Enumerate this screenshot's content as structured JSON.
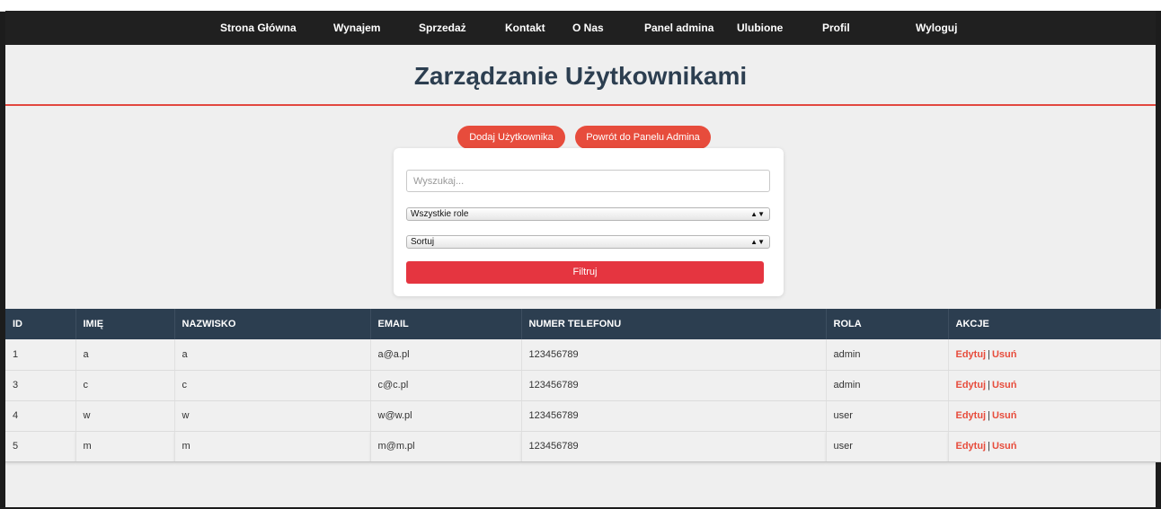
{
  "nav": {
    "items": [
      "Strona Główna",
      "Wynajem",
      "Sprzedaż",
      "Kontakt",
      "O Nas",
      "Panel admina",
      "Ulubione",
      "Profil",
      "Wyloguj"
    ]
  },
  "page": {
    "title": "Zarządzanie Użytkownikami"
  },
  "actions": {
    "add_user": "Dodaj Użytkownika",
    "back_to_admin": "Powrót do Panelu Admina"
  },
  "filter": {
    "search_placeholder": "Wyszukaj...",
    "role_select": "Wszystkie role",
    "sort_select": "Sortuj",
    "filter_button": "Filtruj"
  },
  "table": {
    "headers": [
      "ID",
      "IMIĘ",
      "NAZWISKO",
      "EMAIL",
      "NUMER TELEFONU",
      "ROLA",
      "AKCJE"
    ],
    "edit_label": "Edytuj",
    "separator": "|",
    "delete_label": "Usuń",
    "rows": [
      {
        "id": "1",
        "first": "a",
        "last": "a",
        "email": "a@a.pl",
        "phone": "123456789",
        "role": "admin"
      },
      {
        "id": "3",
        "first": "c",
        "last": "c",
        "email": "c@c.pl",
        "phone": "123456789",
        "role": "admin"
      },
      {
        "id": "4",
        "first": "w",
        "last": "w",
        "email": "w@w.pl",
        "phone": "123456789",
        "role": "user"
      },
      {
        "id": "5",
        "first": "m",
        "last": "m",
        "email": "m@m.pl",
        "phone": "123456789",
        "role": "user"
      }
    ]
  },
  "colors": {
    "nav_bg": "#202020",
    "title": "#2c3e50",
    "accent": "#e74c3c",
    "table_header": "#2c3e50"
  }
}
